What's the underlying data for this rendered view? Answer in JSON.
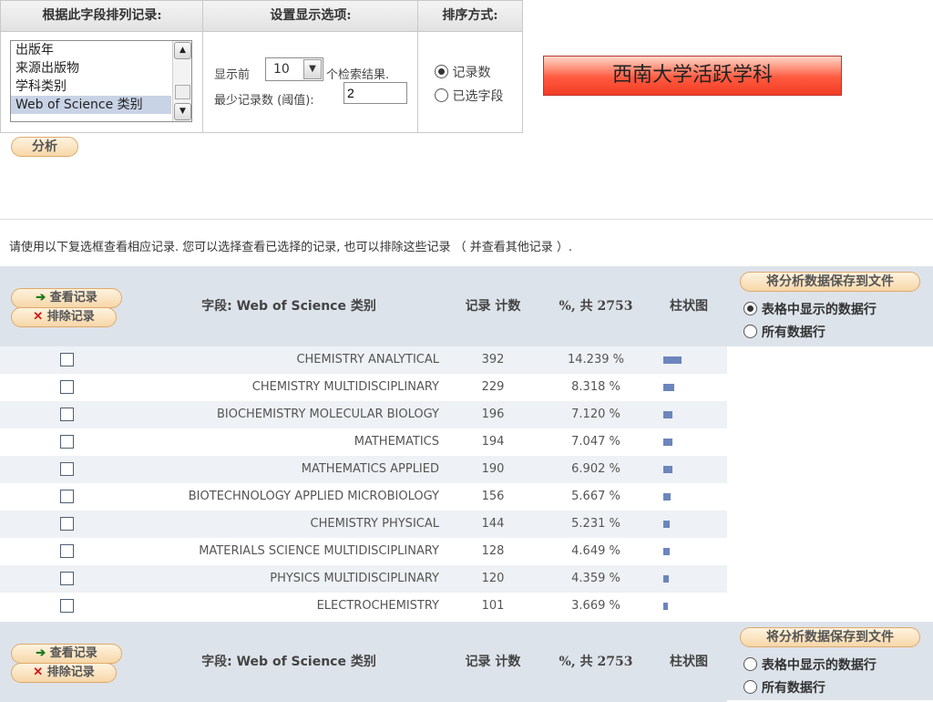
{
  "panels": {
    "rank_field": {
      "title": "根据此字段排列记录:",
      "options": [
        "出版年",
        "来源出版物",
        "学科类别",
        "Web of Science 类别"
      ],
      "selected_index": 3
    },
    "display": {
      "title": "设置显示选项:",
      "show_prefix": "显示前",
      "show_value": "10",
      "show_suffix": "个检索结果.",
      "min_label": "最少记录数 (阈值):",
      "min_value": "2"
    },
    "sort": {
      "title": "排序方式:",
      "options": [
        "记录数",
        "已选字段"
      ],
      "selected_index": 0
    }
  },
  "analyze_label": "分析",
  "banner_text": "西南大学活跃学科",
  "instructions": "请使用以下复选框查看相应记录. 您可以选择查看已选择的记录, 也可以排除这些记录 （ 并查看其他记录 ）.",
  "table": {
    "actions": {
      "view": "查看记录",
      "exclude": "排除记录"
    },
    "headers": {
      "field": "字段: Web of Science 类别",
      "count": "记录 计数",
      "percent": "%, 共 2753",
      "chart": "柱状图"
    },
    "save": {
      "button": "将分析数据保存到文件",
      "opt_shown": "表格中显示的数据行",
      "opt_all": "所有数据行"
    },
    "top_save_selected": 0,
    "bottom_save_selected": -1,
    "rows": [
      {
        "name": "CHEMISTRY ANALYTICAL",
        "count": "392",
        "percent": "14.239 %",
        "bar": 14.239
      },
      {
        "name": "CHEMISTRY MULTIDISCIPLINARY",
        "count": "229",
        "percent": "8.318 %",
        "bar": 8.318
      },
      {
        "name": "BIOCHEMISTRY MOLECULAR BIOLOGY",
        "count": "196",
        "percent": "7.120 %",
        "bar": 7.12
      },
      {
        "name": "MATHEMATICS",
        "count": "194",
        "percent": "7.047 %",
        "bar": 7.047
      },
      {
        "name": "MATHEMATICS APPLIED",
        "count": "190",
        "percent": "6.902 %",
        "bar": 6.902
      },
      {
        "name": "BIOTECHNOLOGY APPLIED MICROBIOLOGY",
        "count": "156",
        "percent": "5.667 %",
        "bar": 5.667
      },
      {
        "name": "CHEMISTRY PHYSICAL",
        "count": "144",
        "percent": "5.231 %",
        "bar": 5.231
      },
      {
        "name": "MATERIALS SCIENCE MULTIDISCIPLINARY",
        "count": "128",
        "percent": "4.649 %",
        "bar": 4.649
      },
      {
        "name": "PHYSICS MULTIDISCIPLINARY",
        "count": "120",
        "percent": "4.359 %",
        "bar": 4.359
      },
      {
        "name": "ELECTROCHEMISTRY",
        "count": "101",
        "percent": "3.669 %",
        "bar": 3.669
      }
    ]
  },
  "colors": {
    "header_bg": "#dde3ea",
    "alt_row": "#eef1f5",
    "bar": "#6b86bd",
    "banner": "#ff5a40"
  }
}
